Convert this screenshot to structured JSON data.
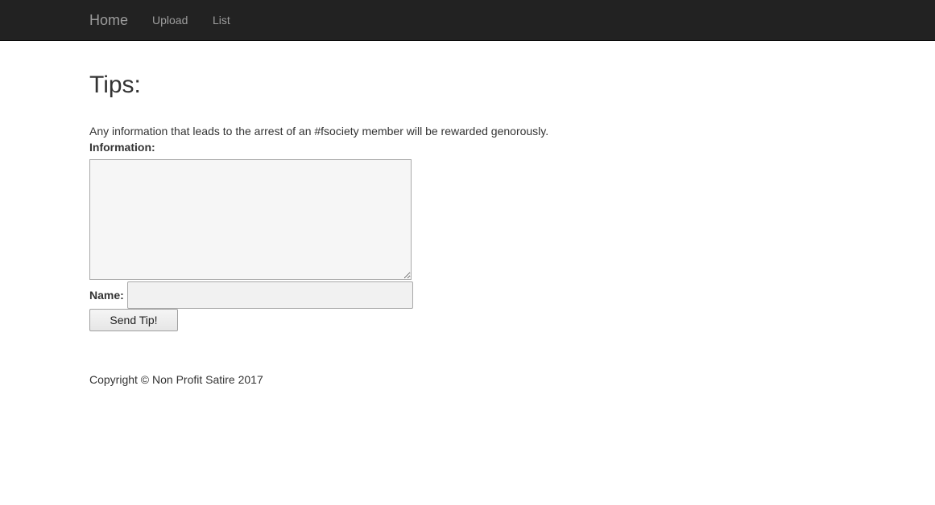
{
  "nav": {
    "brand": "Home",
    "links": [
      {
        "label": "Upload"
      },
      {
        "label": "List"
      }
    ]
  },
  "main": {
    "title": "Tips:",
    "intro": "Any information that leads to the arrest of an #fsociety member will be rewarded genorously.",
    "information_label": "Information:",
    "information_value": "",
    "name_label": "Name:",
    "name_value": "",
    "submit_label": "Send Tip!"
  },
  "footer": {
    "copyright": "Copyright © Non Profit Satire 2017"
  },
  "colors": {
    "navbar_bg": "#222222",
    "nav_text": "#9d9d9d",
    "body_text": "#333333",
    "textarea_bg": "#f6f6f6"
  }
}
